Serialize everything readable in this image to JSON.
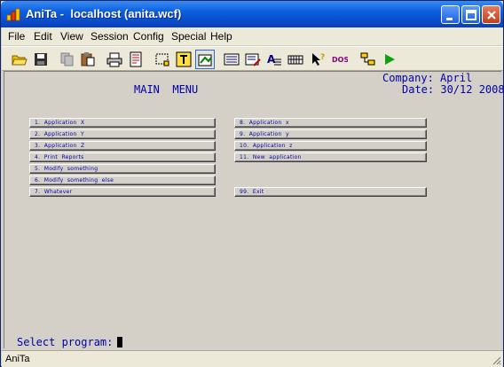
{
  "window": {
    "app_name": "AniTa -",
    "title": "localhost (anita.wcf)"
  },
  "menu": [
    "File",
    "Edit",
    "View",
    "Session",
    "Config",
    "Special",
    "Help"
  ],
  "toolbar": {
    "icons": [
      "open-folder-icon",
      "save-icon",
      "copy-icon",
      "paste-icon",
      "print-icon",
      "print-preview-icon",
      "select-icon",
      "text-mode-icon",
      "transfer-icon",
      "screen-icon",
      "screen-edit-icon",
      "font-icon",
      "keyboard-icon",
      "help-cursor-icon",
      "dos-icon",
      "connect-icon",
      "run-icon"
    ],
    "font_label": "A",
    "dos_label": "DOS"
  },
  "screen": {
    "company": "Company: April",
    "date": "Date: 30/12 2008",
    "heading": "MAIN  MENU",
    "left_items": [
      "1.  Application  X",
      "2.  Application  Y",
      "3.  Application  Z",
      "4.  Print  Reports",
      "5.  Modify  something",
      "6.  Modify  something  else",
      "7.  Whatever"
    ],
    "right_items": [
      "8.  Application  x",
      "9.  Application  y",
      "10.  Application  z",
      "11.  New  application"
    ],
    "exit_item": "99.  Exit",
    "prompt": "Select program:"
  },
  "status": {
    "text": "AniTa"
  },
  "colors": {
    "terminal_text": "#0000a8",
    "titlebar": "#0a4fd0",
    "background": "#d4d0c8"
  }
}
